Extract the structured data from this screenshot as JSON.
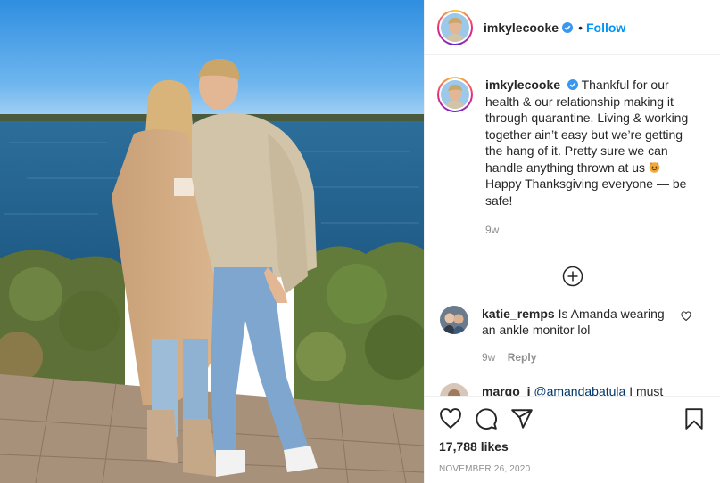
{
  "post": {
    "username": "imkylecooke",
    "follow_label": "Follow",
    "separator": "•"
  },
  "caption": {
    "username": "imkylecooke",
    "text": "Thankful for our health & our relationship making it through quarantine. Living & working together ain’t easy but we’re getting the hang of it. Pretty sure we can handle anything thrown at us",
    "text_after_emoji": "Happy Thanksgiving everyone — be safe!",
    "emoji": "smiling-face-with-horns",
    "age": "9w"
  },
  "comments": [
    {
      "username": "katie_remps",
      "text": "Is Amanda wearing an ankle monitor lol",
      "age": "9w",
      "reply_label": "Reply"
    },
    {
      "username": "margo_j",
      "mention": "@amandabatula",
      "text": "I must"
    }
  ],
  "actions": {
    "likes": "17,788 likes",
    "date": "NOVEMBER 26, 2020"
  },
  "icons": {
    "verified": "verified-badge-icon",
    "load_more": "plus-circle-icon",
    "like": "heart-icon",
    "comment": "comment-icon",
    "share": "share-icon",
    "save": "bookmark-icon"
  },
  "colors": {
    "link_blue": "#0095f6",
    "muted": "#8e8e8e",
    "text": "#262626",
    "border": "#efefef"
  }
}
